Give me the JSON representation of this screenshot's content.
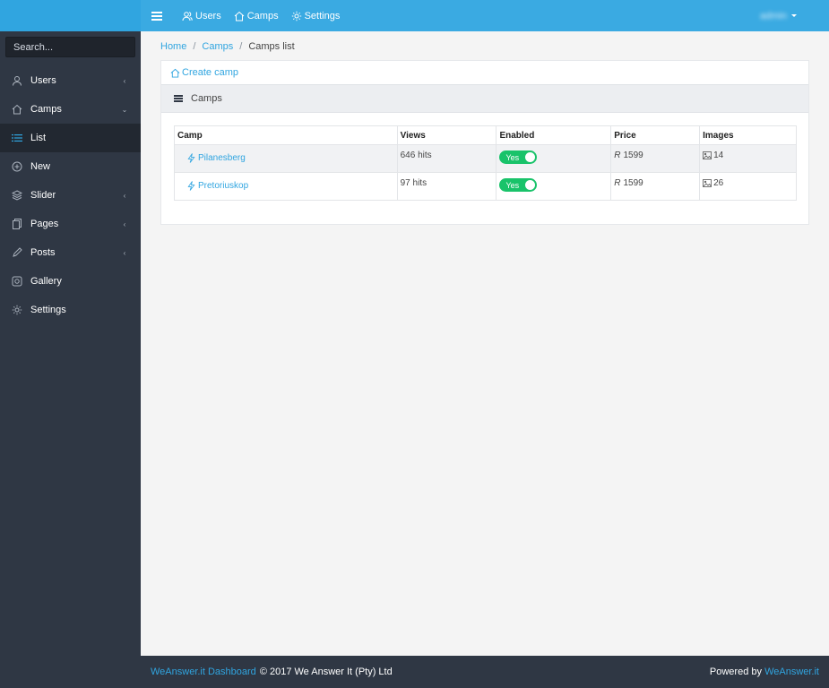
{
  "sidebar": {
    "search_placeholder": "Search...",
    "items": [
      {
        "label": "Users",
        "icon": "user-icon",
        "caret": "‹"
      },
      {
        "label": "Camps",
        "icon": "home-icon",
        "caret": "⌄"
      },
      {
        "label": "List",
        "icon": "list-icon",
        "caret": ""
      },
      {
        "label": "New",
        "icon": "plus-circle-icon",
        "caret": ""
      },
      {
        "label": "Slider",
        "icon": "layers-icon",
        "caret": "‹"
      },
      {
        "label": "Pages",
        "icon": "pages-icon",
        "caret": "‹"
      },
      {
        "label": "Posts",
        "icon": "pencil-icon",
        "caret": "‹"
      },
      {
        "label": "Gallery",
        "icon": "gallery-icon",
        "caret": ""
      },
      {
        "label": "Settings",
        "icon": "gear-icon",
        "caret": ""
      }
    ]
  },
  "topbar": {
    "links": [
      {
        "label": "Users",
        "icon": "users-icon"
      },
      {
        "label": "Camps",
        "icon": "home-icon"
      },
      {
        "label": "Settings",
        "icon": "gear-icon"
      }
    ],
    "user": "admin"
  },
  "breadcrumb": {
    "home": "Home",
    "camps": "Camps",
    "current": "Camps list",
    "separator": "/"
  },
  "card": {
    "create_label": "Create camp",
    "header_title": "Camps"
  },
  "table": {
    "columns": [
      "Camp",
      "Views",
      "Enabled",
      "Price",
      "Images"
    ],
    "rows": [
      {
        "camp": "Pilanesberg",
        "views": "646 hits",
        "enabled": "Yes",
        "currency": "R",
        "price": "1599",
        "images": "14"
      },
      {
        "camp": "Pretoriuskop",
        "views": "97 hits",
        "enabled": "Yes",
        "currency": "R",
        "price": "1599",
        "images": "26"
      }
    ]
  },
  "footer": {
    "brand_link": "WeAnswer.it Dashboard",
    "copyright": "© 2017 We Answer It (Pty) Ltd",
    "powered_prefix": "Powered by",
    "powered_link": "WeAnswer.it"
  },
  "colors": {
    "accent": "#30a5e0",
    "sidebar": "#2f3744",
    "toggle_on": "#19c36a"
  }
}
